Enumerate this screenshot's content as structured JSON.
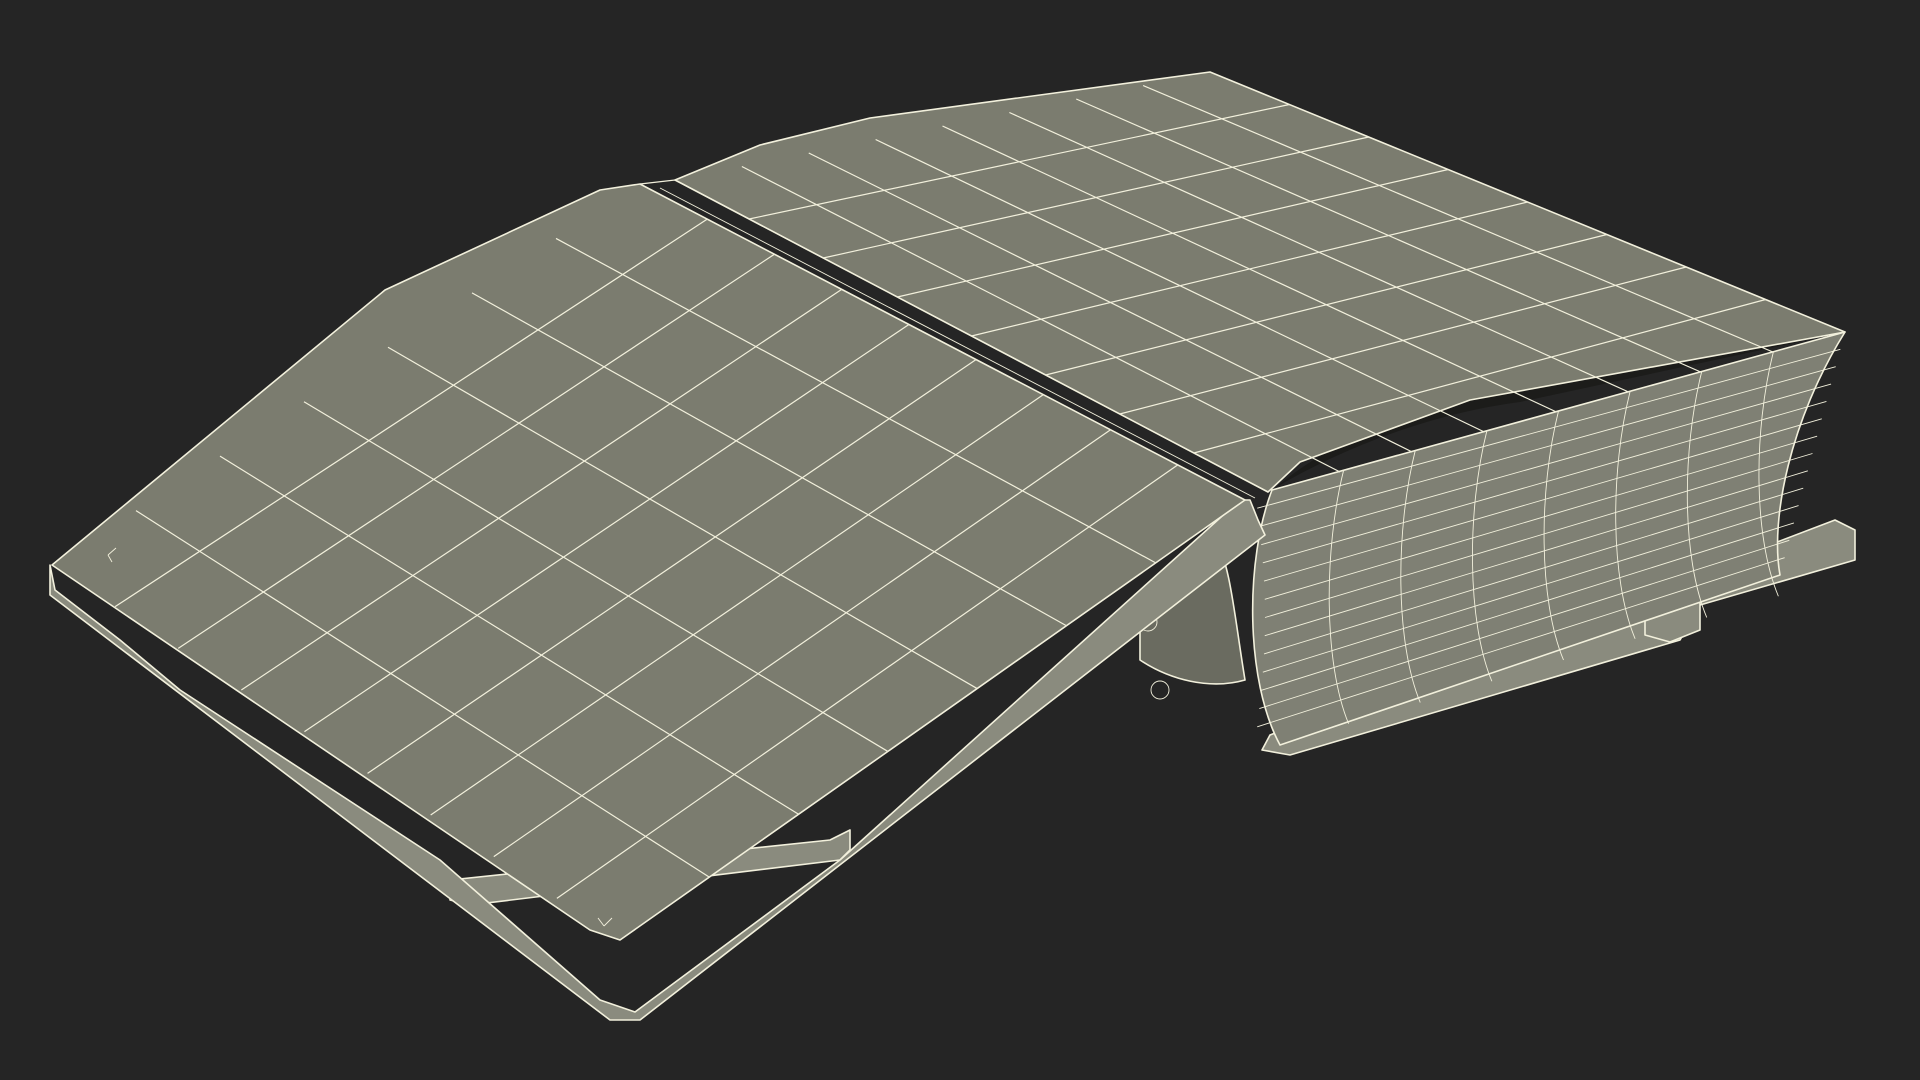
{
  "viewport": {
    "background_color": "#252525",
    "wire_color": "#f2f0dc"
  },
  "model": {
    "surface_color": "#7b7c6f",
    "surface_dark_color": "#6a6b60",
    "side_color": "#8a8b7e",
    "page_color": "#7f8074",
    "shadow_color": "#1c1c1a"
  }
}
